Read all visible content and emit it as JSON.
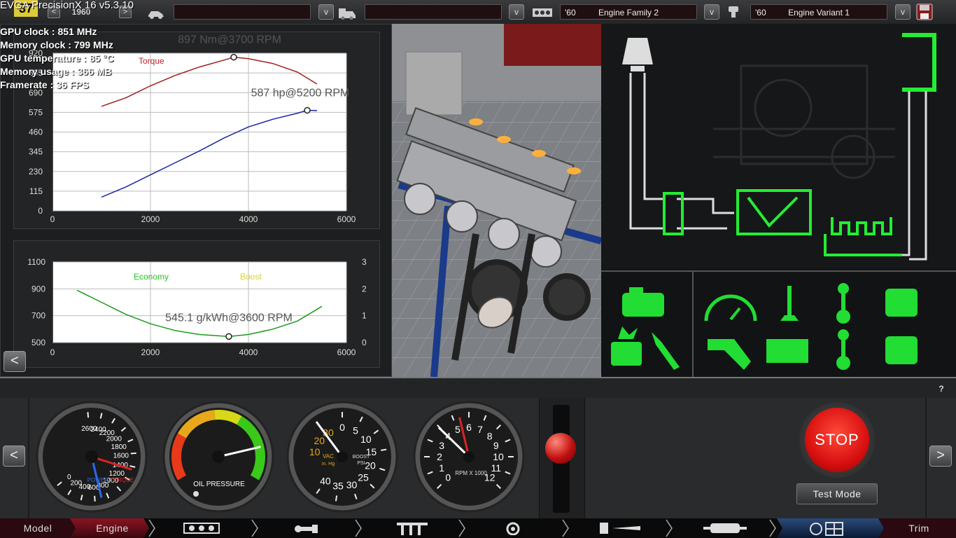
{
  "osd": {
    "title": "EVGA PrecisionX 16 v5.3.10",
    "fps_badge": "37",
    "lines": [
      "GPU clock : 851 MHz",
      "Memory clock : 799 MHz",
      "GPU temperature : 85 °C",
      "Memory usage : 366 MB",
      "Framerate : 36 FPS"
    ]
  },
  "topbar": {
    "year_field": "1960",
    "family": {
      "year": "'60",
      "name": "Engine Family 2"
    },
    "variant": {
      "year": "'60",
      "name": "Engine Variant 1"
    },
    "dropdown_glyph": "v",
    "nav_prev": "<",
    "nav_next": ">"
  },
  "power_chart": {
    "torque_label": "Torque",
    "torque_annotation": "897 Nm@3700 RPM",
    "power_annotation": "587 hp@5200 RPM",
    "colors": {
      "torque": "#a31d1d",
      "power": "#1a26a6"
    }
  },
  "economy_chart": {
    "economy_label": "Economy",
    "boost_label": "Boost",
    "annotation": "545.1 g/kWh@3600 RPM",
    "colors": {
      "economy": "#25c425",
      "boost": "#d8d32a",
      "curve": "#1a9a1a"
    }
  },
  "chart_data": [
    {
      "type": "line",
      "title": "",
      "xlabel": "",
      "ylabel": "",
      "xlim": [
        0,
        6000
      ],
      "ylim": [
        0,
        920
      ],
      "x_ticks": [
        "0",
        "2000",
        "4000",
        "6000"
      ],
      "y_ticks": [
        "0",
        "115",
        "230",
        "345",
        "460",
        "575",
        "690",
        "805",
        "920"
      ],
      "grid": true,
      "series": [
        {
          "name": "Torque",
          "x": [
            1000,
            1500,
            2000,
            2500,
            3000,
            3500,
            3700,
            4000,
            4500,
            5000,
            5400
          ],
          "y": [
            610,
            660,
            730,
            790,
            840,
            880,
            897,
            888,
            860,
            810,
            740
          ]
        },
        {
          "name": "",
          "x": [
            1000,
            1500,
            2000,
            2500,
            3000,
            3500,
            4000,
            4500,
            5000,
            5200,
            5400
          ],
          "y": [
            80,
            140,
            210,
            280,
            350,
            425,
            490,
            535,
            570,
            587,
            585
          ]
        }
      ],
      "markers": [
        {
          "label": "897 Nm@3700 RPM",
          "x": 3700,
          "y": 897
        },
        {
          "label": "587 hp@5200 RPM",
          "x": 5200,
          "y": 587
        }
      ]
    },
    {
      "type": "line",
      "title": "",
      "xlim": [
        0,
        6000
      ],
      "ylim": [
        500,
        1100
      ],
      "y2lim": [
        0,
        3
      ],
      "x_ticks": [
        "0",
        "2000",
        "4000",
        "6000"
      ],
      "y_ticks": [
        "500",
        "700",
        "900",
        "1100"
      ],
      "y2_ticks": [
        "0",
        "1",
        "2",
        "3"
      ],
      "grid": true,
      "legend": [
        "Economy",
        "Boost"
      ],
      "series": [
        {
          "name": "Economy",
          "x": [
            500,
            1000,
            1500,
            2000,
            2500,
            3000,
            3600,
            4000,
            4500,
            5000,
            5500
          ],
          "y": [
            890,
            800,
            710,
            640,
            590,
            560,
            545.1,
            560,
            600,
            660,
            770
          ]
        }
      ],
      "markers": [
        {
          "label": "545.1 g/kWh@3600 RPM",
          "x": 3600,
          "y": 545.1
        }
      ]
    }
  ],
  "gauges": {
    "torque": {
      "ticks": [
        "2600",
        "2400",
        "2200",
        "2000",
        "1800",
        "1600",
        "1400",
        "1200",
        "1000",
        "800",
        "600",
        "400",
        "200",
        "0"
      ],
      "caption_a": "POWER",
      "caption_sep": "/",
      "caption_b": "TORQUE",
      "power_needle": 0.73,
      "torque_needle": 0.48
    },
    "oil": {
      "caption": "OIL PRESSURE",
      "needle": 0.82
    },
    "boost": {
      "ticks": [
        "0",
        "5",
        "10",
        "15",
        "20",
        "25",
        "30",
        "35",
        "40"
      ],
      "vac_ticks": [
        "10",
        "20",
        "30"
      ],
      "vac_caption": "VAC",
      "vac_unit": "in. Hg",
      "boost_caption": "BOOST",
      "boost_unit": "PSI",
      "needle": 0.05
    },
    "rpm": {
      "ticks": [
        "0",
        "1",
        "2",
        "3",
        "4",
        "5",
        "6",
        "7",
        "8",
        "9",
        "10",
        "11",
        "12"
      ],
      "caption": "RPM X 1000",
      "needle": 0.33,
      "redline_needle": 0.45
    }
  },
  "controls": {
    "stop_label": "STOP",
    "test_mode_label": "Test Mode",
    "help_label": "?",
    "left_arrow": "<",
    "right_arrow": ">"
  },
  "tabs": {
    "model": "Model",
    "engine": "Engine",
    "trim": "Trim"
  },
  "icons": {
    "intake": "air-filter-icon",
    "exhaust": "exhaust-icon",
    "cylinder": "engine-block-icon",
    "crank": "crankshaft-icon",
    "turbo": "turbo-icon",
    "fuel": "fuel-icon",
    "muffler": "muffler-icon",
    "dyno": "dyno-icon"
  },
  "theme": {
    "accent_green": "#22ee33",
    "stop_red": "#e81818",
    "tab_engine_red": "#c0202a"
  }
}
